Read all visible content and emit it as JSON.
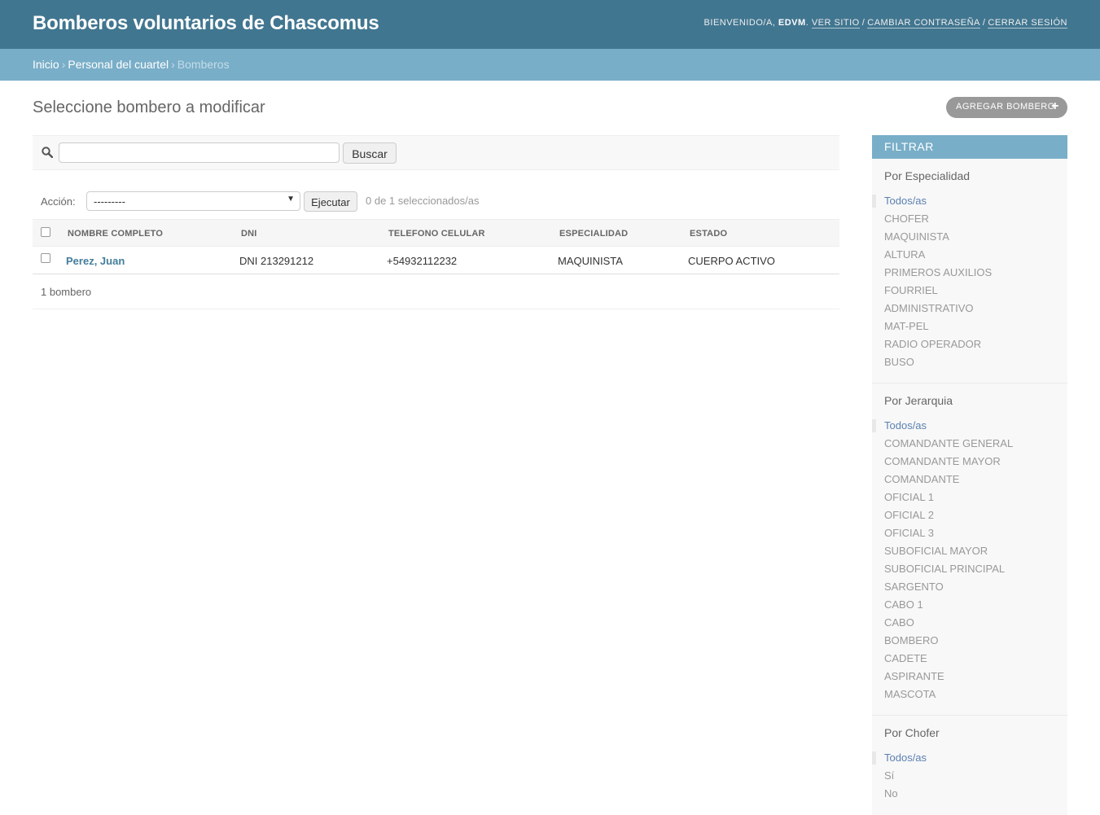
{
  "header": {
    "site_name": "Bomberos voluntarios de Chascomus",
    "welcome": "BIENVENIDO/A,",
    "username": "EDVM",
    "view_site": "VER SITIO",
    "change_password": "CAMBIAR CONTRASEÑA",
    "logout": "CERRAR SESIÓN"
  },
  "breadcrumbs": {
    "home": "Inicio",
    "app": "Personal del cuartel",
    "current": "Bomberos"
  },
  "content": {
    "title": "Seleccione bombero a modificar",
    "add_button": "AGREGAR BOMBERO"
  },
  "search": {
    "value": "",
    "button": "Buscar"
  },
  "actions": {
    "label": "Acción:",
    "selected": "---------",
    "go": "Ejecutar",
    "counter": "0 de 1 seleccionados/as"
  },
  "table": {
    "columns": [
      "NOMBRE COMPLETO",
      "DNI",
      "TELEFONO CELULAR",
      "ESPECIALIDAD",
      "ESTADO"
    ],
    "rows": [
      {
        "name": "Perez, Juan",
        "dni": "DNI 213291212",
        "phone": "+54932112232",
        "specialty": "MAQUINISTA",
        "status": "CUERPO ACTIVO"
      }
    ]
  },
  "paginator": "1 bombero",
  "filter": {
    "title": "FILTRAR",
    "groups": [
      {
        "title": "Por Especialidad",
        "items": [
          "Todos/as",
          "CHOFER",
          "MAQUINISTA",
          "ALTURA",
          "PRIMEROS AUXILIOS",
          "FOURRIEL",
          "ADMINISTRATIVO",
          "MAT-PEL",
          "RADIO OPERADOR",
          "BUSO"
        ]
      },
      {
        "title": "Por Jerarquia",
        "items": [
          "Todos/as",
          "COMANDANTE GENERAL",
          "COMANDANTE MAYOR",
          "COMANDANTE",
          "OFICIAL 1",
          "OFICIAL 2",
          "OFICIAL 3",
          "SUBOFICIAL MAYOR",
          "SUBOFICIAL PRINCIPAL",
          "SARGENTO",
          "CABO 1",
          "CABO",
          "BOMBERO",
          "CADETE",
          "ASPIRANTE",
          "MASCOTA"
        ]
      },
      {
        "title": "Por Chofer",
        "items": [
          "Todos/as",
          "Sí",
          "No"
        ]
      }
    ]
  },
  "colors": {
    "header_bg": "#417690",
    "breadcrumbs_bg": "#79aec8",
    "link": "#447e9b"
  }
}
